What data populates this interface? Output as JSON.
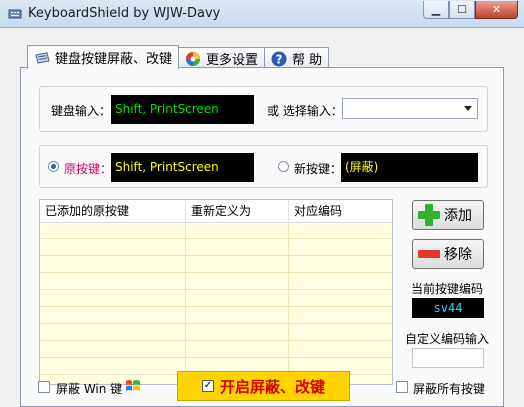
{
  "window": {
    "title": "KeyboardShield by WJW-Davy"
  },
  "tabs": [
    {
      "label": "键盘按键屏蔽、改键",
      "icon": "keyboard-icon"
    },
    {
      "label": "更多设置",
      "icon": "color-wheel-icon"
    },
    {
      "label": "帮 助",
      "icon": "help-icon"
    }
  ],
  "keyboard_input": {
    "label": "键盘输入：",
    "value": "Shift, PrintScreen"
  },
  "select_input": {
    "label": "或 选择输入：",
    "value": ""
  },
  "original_key": {
    "label": "原按键：",
    "value": "Shift, PrintScreen"
  },
  "new_key": {
    "label": "新按键：",
    "value": "(屏蔽)"
  },
  "table": {
    "headers": [
      "已添加的原按键",
      "重新定义为",
      "对应编码"
    ],
    "rows": []
  },
  "buttons": {
    "add": "添加",
    "remove": "移除"
  },
  "current_code": {
    "label": "当前按键编码",
    "value": "sv44"
  },
  "custom_code": {
    "label": "自定义编码输入",
    "value": ""
  },
  "footer": {
    "block_win": "屏蔽 Win 键",
    "start": "开启屏蔽、改键",
    "block_all": "屏蔽所有按键"
  },
  "colors": {
    "input_bg": "#000000",
    "green_text": "#00e000",
    "yellow_text": "#ffff00",
    "original_label": "#cc0066",
    "code_text": "#3fd0ff",
    "start_bg": "#ffd400",
    "start_text": "#d60000"
  }
}
